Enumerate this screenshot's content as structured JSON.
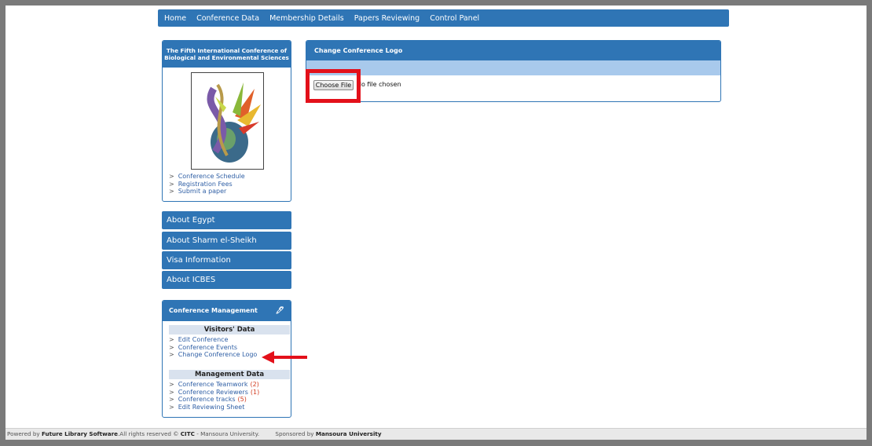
{
  "topnav": {
    "items": [
      "Home",
      "Conference Data",
      "Membership Details",
      "Papers Reviewing",
      "Control Panel"
    ]
  },
  "conference": {
    "title_line1": "The Fifth International Conference of",
    "title_line2": "Biological and Environmental Sciences",
    "links": [
      "Conference Schedule",
      "Registration Fees",
      "Submit a paper"
    ]
  },
  "sidebar": {
    "items": [
      "About Egypt",
      "About Sharm el-Sheikh",
      "Visa Information",
      "About ICBES"
    ]
  },
  "management": {
    "title": "Conference Management",
    "visitors_header": "Visitors' Data",
    "visitors_links": [
      "Edit Conference",
      "Conference Events",
      "Change Conference Logo"
    ],
    "mgmt_header": "Management Data",
    "mgmt_links": [
      {
        "label": "Conference Teamwork",
        "count": "(2)"
      },
      {
        "label": "Conference Reviewers",
        "count": "(1)"
      },
      {
        "label": "Conference tracks",
        "count": "(5)"
      },
      {
        "label": "Edit Reviewing Sheet",
        "count": ""
      }
    ]
  },
  "main": {
    "title": "Change Conference Logo",
    "choose_file": "Choose File",
    "no_file": "No file chosen"
  },
  "footer": {
    "powered": "Powered by",
    "software": "Future Library Software",
    "rights": ".All rights reserved ©",
    "citc": "CITC",
    "univ": "- Mansoura University.",
    "sponsored": "Sponsored by",
    "sponsor": "Mansoura University"
  },
  "colors": {
    "primary": "#2f75b5",
    "highlight": "#e3101a",
    "count": "#d23a1e"
  }
}
